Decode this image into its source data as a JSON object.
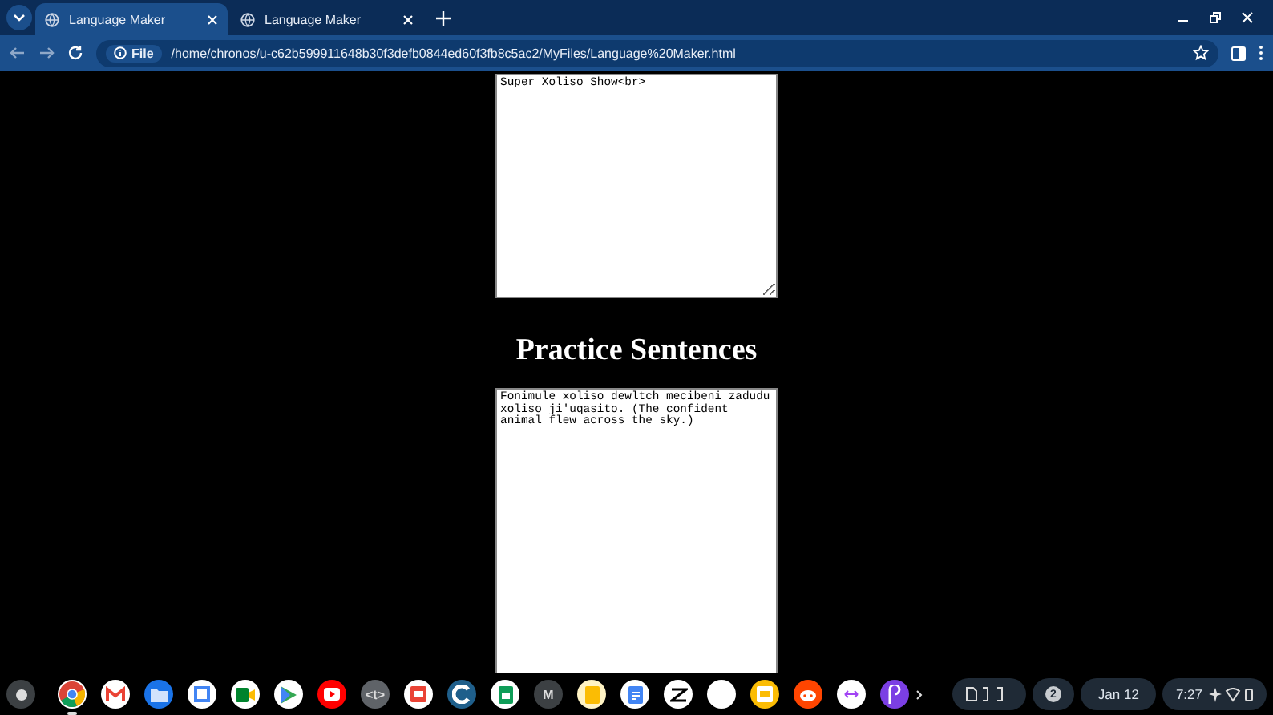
{
  "tabs": [
    {
      "title": "Language Maker",
      "selected": true
    },
    {
      "title": "Language Maker",
      "selected": false
    }
  ],
  "address_bar": {
    "scheme": "File",
    "url": "/home/chronos/u-c62b599911648b30f3defb0844ed60f3fb8c5ac2/MyFiles/Language%20Maker.html"
  },
  "page": {
    "top_textarea": {
      "value": "Super Xoliso Show<br>"
    },
    "heading": "Practice Sentences",
    "bottom_textarea": {
      "value": "Fonimule xoliso dewltch mecibeni zadudu xoliso ji'uqasito. (The confident animal flew across the sky.)"
    }
  },
  "shelf": {
    "apps": [
      {
        "kind": "chrome",
        "color": "#ffffff",
        "running": true
      },
      {
        "kind": "gmail",
        "color": "#ffffff",
        "running": false
      },
      {
        "kind": "files",
        "color": "#1a73e8",
        "running": false
      },
      {
        "kind": "calendar",
        "color": "#ffffff",
        "running": false
      },
      {
        "kind": "meet",
        "color": "#ffffff",
        "running": false
      },
      {
        "kind": "play",
        "color": "#ffffff",
        "running": false
      },
      {
        "kind": "youtube",
        "color": "#ff0000",
        "running": false
      },
      {
        "kind": "glyph",
        "color": "#5f6368",
        "glyph": "<t>",
        "running": false
      },
      {
        "kind": "slides",
        "color": "#ffffff",
        "running": false
      },
      {
        "kind": "ring",
        "color": "#1f5f8b",
        "running": false
      },
      {
        "kind": "sheets",
        "color": "#ffffff",
        "running": false
      },
      {
        "kind": "glyph",
        "color": "#3c4043",
        "glyph": "M",
        "running": false
      },
      {
        "kind": "keep",
        "color": "#fff3c4",
        "running": false
      },
      {
        "kind": "docs",
        "color": "#ffffff",
        "running": false
      },
      {
        "kind": "capcut",
        "color": "#ffffff",
        "running": false
      },
      {
        "kind": "blank",
        "color": "#ffffff",
        "running": false
      },
      {
        "kind": "slides",
        "color": "#fbbc04",
        "running": false
      },
      {
        "kind": "reddit",
        "color": "#ff4500",
        "running": false
      },
      {
        "kind": "arrows",
        "color": "#ffffff",
        "running": false
      },
      {
        "kind": "swirl",
        "color": "#7b3fe4",
        "running": false
      }
    ],
    "notification_count": "2",
    "date": "Jan 12",
    "time": "7:27"
  }
}
